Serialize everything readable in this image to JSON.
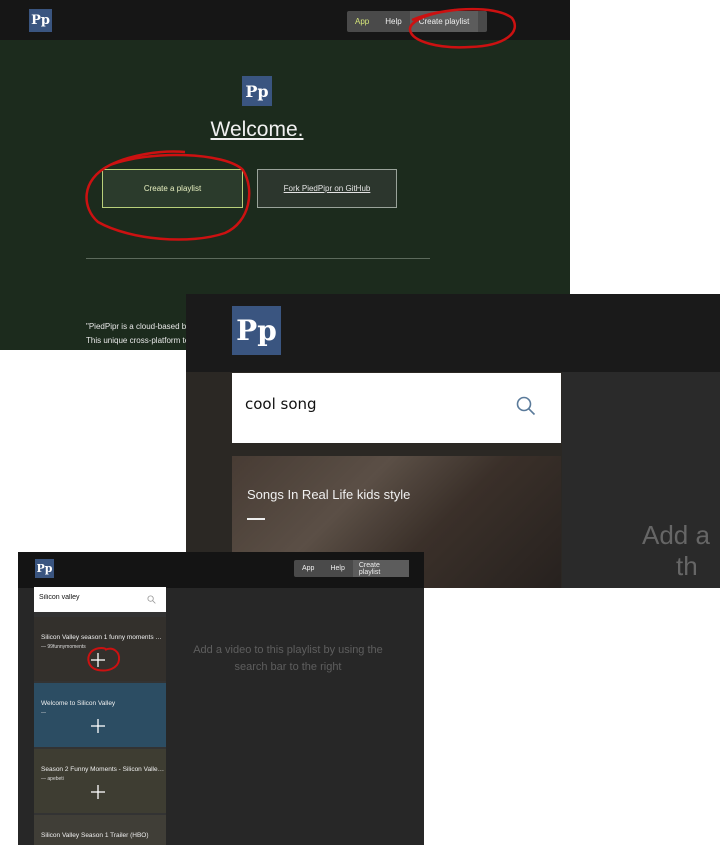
{
  "brand": {
    "logo_text": "Pp"
  },
  "screen1": {
    "nav": {
      "app": "App",
      "help": "Help",
      "create": "Create playlist"
    },
    "welcome": "Welcome.",
    "create_button": "Create a playlist",
    "fork_button": "Fork PiedPipr on GitHub",
    "about_line1": "\"PiedPipr is a cloud-based busi",
    "about_line2": "This unique cross-platform tec"
  },
  "screen2": {
    "search_value": "cool song",
    "video_title": "Songs In Real Life kids style",
    "add_text_line1": "Add a",
    "add_text_line2": "th"
  },
  "screen3": {
    "nav": {
      "app": "App",
      "help": "Help",
      "create": "Create playlist"
    },
    "search_value": "Silicon valley",
    "results": [
      {
        "title": "Silicon Valley season 1 funny moments co...",
        "channel": "— 99funnymoments",
        "color": "#4a4540"
      },
      {
        "title": "Welcome to Silicon Valley",
        "channel": "—",
        "color": "#3f6f8f"
      },
      {
        "title": "Season 2 Funny Moments - Silicon Valley ...",
        "channel": "— apebeti",
        "color": "#5a5848"
      },
      {
        "title": "Silicon Valley Season 1 Trailer (HBO)",
        "channel": "",
        "color": "#5c5a50"
      }
    ],
    "add_text": "Add a video to this playlist by using the search bar to the right"
  },
  "colors": {
    "accent_lime": "#b8cf7a",
    "logo_blue": "#3a5580",
    "annotation_red": "#cc1111"
  }
}
